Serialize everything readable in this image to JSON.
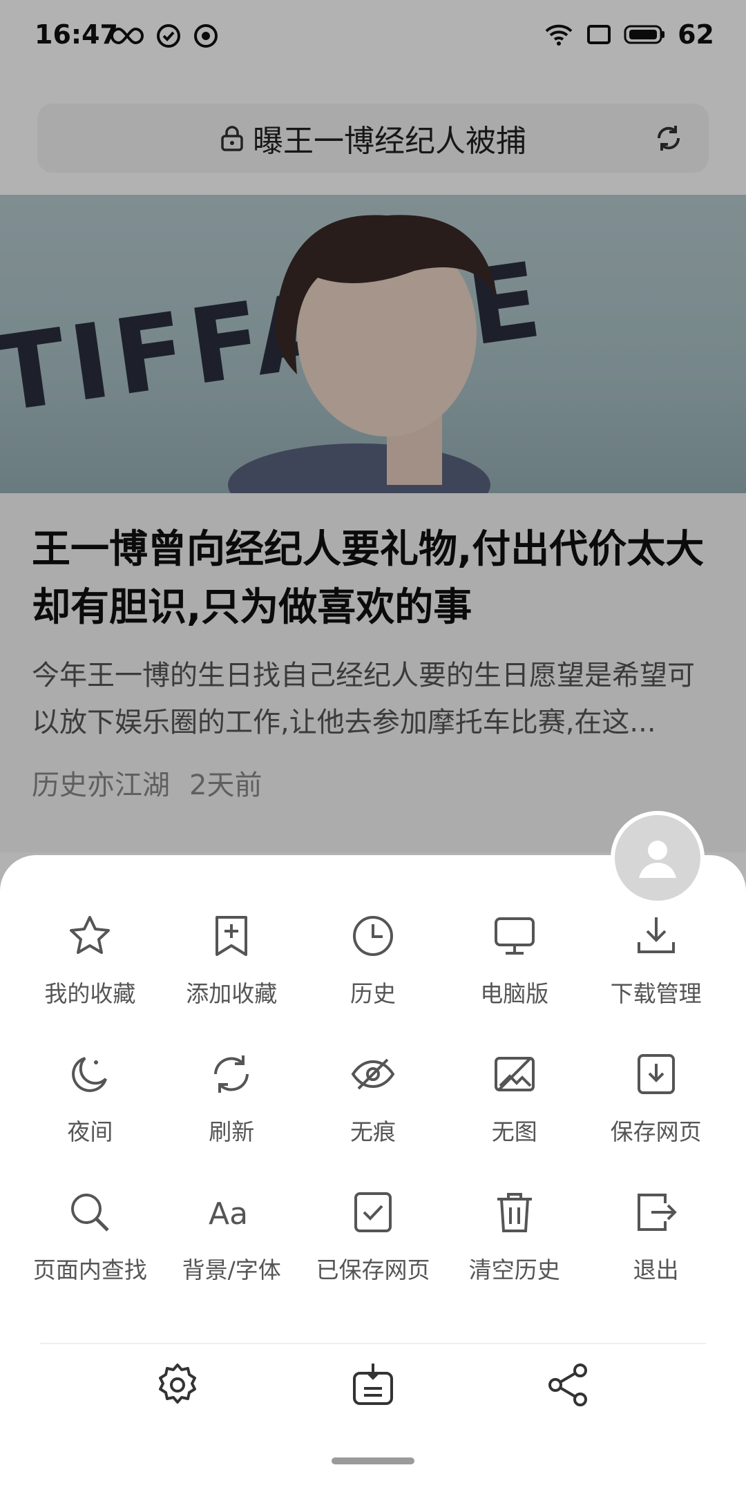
{
  "status_bar": {
    "time": "16:47",
    "battery": "62"
  },
  "url_bar": {
    "query": "曝王一博经纪人被捕"
  },
  "article": {
    "hero_text": "TIFFA     UE",
    "headline": "王一博曾向经纪人要礼物,付出代价太大却有胆识,只为做喜欢的事",
    "summary": "今年王一博的生日找自己经纪人要的生日愿望是希望可以放下娱乐圈的工作,让他去参加摩托车比赛,在这...",
    "source": "历史亦江湖",
    "time_ago": "2天前"
  },
  "menu": {
    "rows": [
      [
        {
          "label": "我的收藏",
          "icon": "star-icon"
        },
        {
          "label": "添加收藏",
          "icon": "bookmark-add-icon"
        },
        {
          "label": "历史",
          "icon": "clock-icon"
        },
        {
          "label": "电脑版",
          "icon": "desktop-icon"
        },
        {
          "label": "下载管理",
          "icon": "download-icon"
        }
      ],
      [
        {
          "label": "夜间",
          "icon": "moon-icon"
        },
        {
          "label": "刷新",
          "icon": "refresh-icon"
        },
        {
          "label": "无痕",
          "icon": "eye-off-icon"
        },
        {
          "label": "无图",
          "icon": "image-off-icon"
        },
        {
          "label": "保存网页",
          "icon": "save-page-icon"
        }
      ],
      [
        {
          "label": "页面内查找",
          "icon": "search-icon"
        },
        {
          "label": "背景/字体",
          "icon": "font-icon"
        },
        {
          "label": "已保存网页",
          "icon": "saved-page-icon"
        },
        {
          "label": "清空历史",
          "icon": "trash-icon"
        },
        {
          "label": "退出",
          "icon": "exit-icon"
        }
      ]
    ],
    "bottom": [
      {
        "icon": "settings-icon"
      },
      {
        "icon": "tray-download-icon"
      },
      {
        "icon": "share-icon"
      }
    ]
  }
}
